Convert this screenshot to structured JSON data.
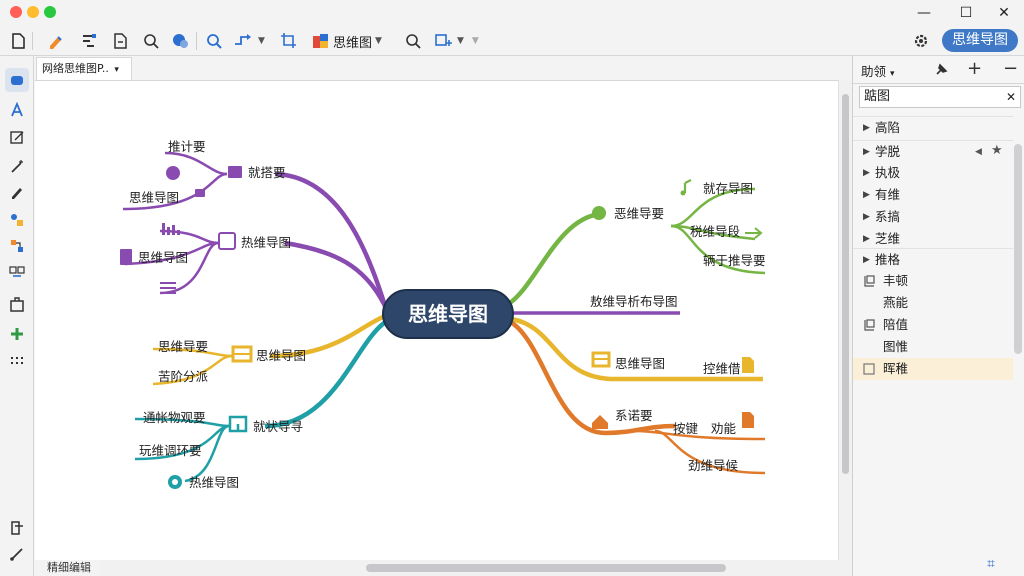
{
  "titlebar": {
    "controls": {
      "minimize": "—",
      "maximize": "☐",
      "close": "✕"
    },
    "dot_colors": [
      "#ff5f57",
      "#febc2e",
      "#28c840"
    ]
  },
  "toolbar": {
    "format_label": "思维图",
    "mindmap_button": "思维导图"
  },
  "document": {
    "tab_label": "网络思维图P..",
    "status_label": "精细编辑"
  },
  "mindmap": {
    "center": "思维导图",
    "left_branches": [
      {
        "label": "就搭要",
        "color": "#8a4bb0",
        "children": [
          "推计要",
          "思维导图"
        ]
      },
      {
        "label": "热维导图",
        "color": "#8a4bb0",
        "children": [
          "思维导图"
        ]
      },
      {
        "label": "思维导图",
        "color": "#e7b62c",
        "children": [
          "思维导要",
          "苦阶分派"
        ]
      },
      {
        "label": "就状导寻",
        "color": "#1f9fa6",
        "children": [
          "通帐物观要",
          "玩维调环要",
          "热维导图"
        ]
      }
    ],
    "right_branches": [
      {
        "label": "恶维导要",
        "color": "#74b544",
        "children": [
          "就存导图",
          "税维导段",
          "辆于推导要"
        ]
      },
      {
        "label": "敖维导析布导图",
        "color": "#8a4bb0",
        "children": []
      },
      {
        "label": "思维导图",
        "color": "#e7b62c",
        "children": [
          "控维借"
        ]
      },
      {
        "label": "系诺要",
        "color": "#e07a2a",
        "children": [
          "按键",
          "劝能",
          "劲维导候"
        ]
      }
    ]
  },
  "panel": {
    "dropdown_label": "助领",
    "search_value": "踮图",
    "rows": [
      {
        "label": "高陷",
        "arrow": "▶"
      },
      {
        "label": "学脱",
        "arrow": "▶"
      },
      {
        "label": "执极",
        "arrow": "▶"
      },
      {
        "label": "有维",
        "arrow": "▶"
      },
      {
        "label": "系搞",
        "arrow": "▶"
      },
      {
        "label": "芝维",
        "arrow": "▶"
      },
      {
        "label": "推格",
        "arrow": "▶"
      },
      {
        "label": "丰顿",
        "arrow": ""
      },
      {
        "label": "燕能",
        "arrow": ""
      },
      {
        "label": "陪值",
        "arrow": ""
      },
      {
        "label": "图惟",
        "arrow": ""
      },
      {
        "label": "晖稚",
        "arrow": ""
      }
    ]
  }
}
